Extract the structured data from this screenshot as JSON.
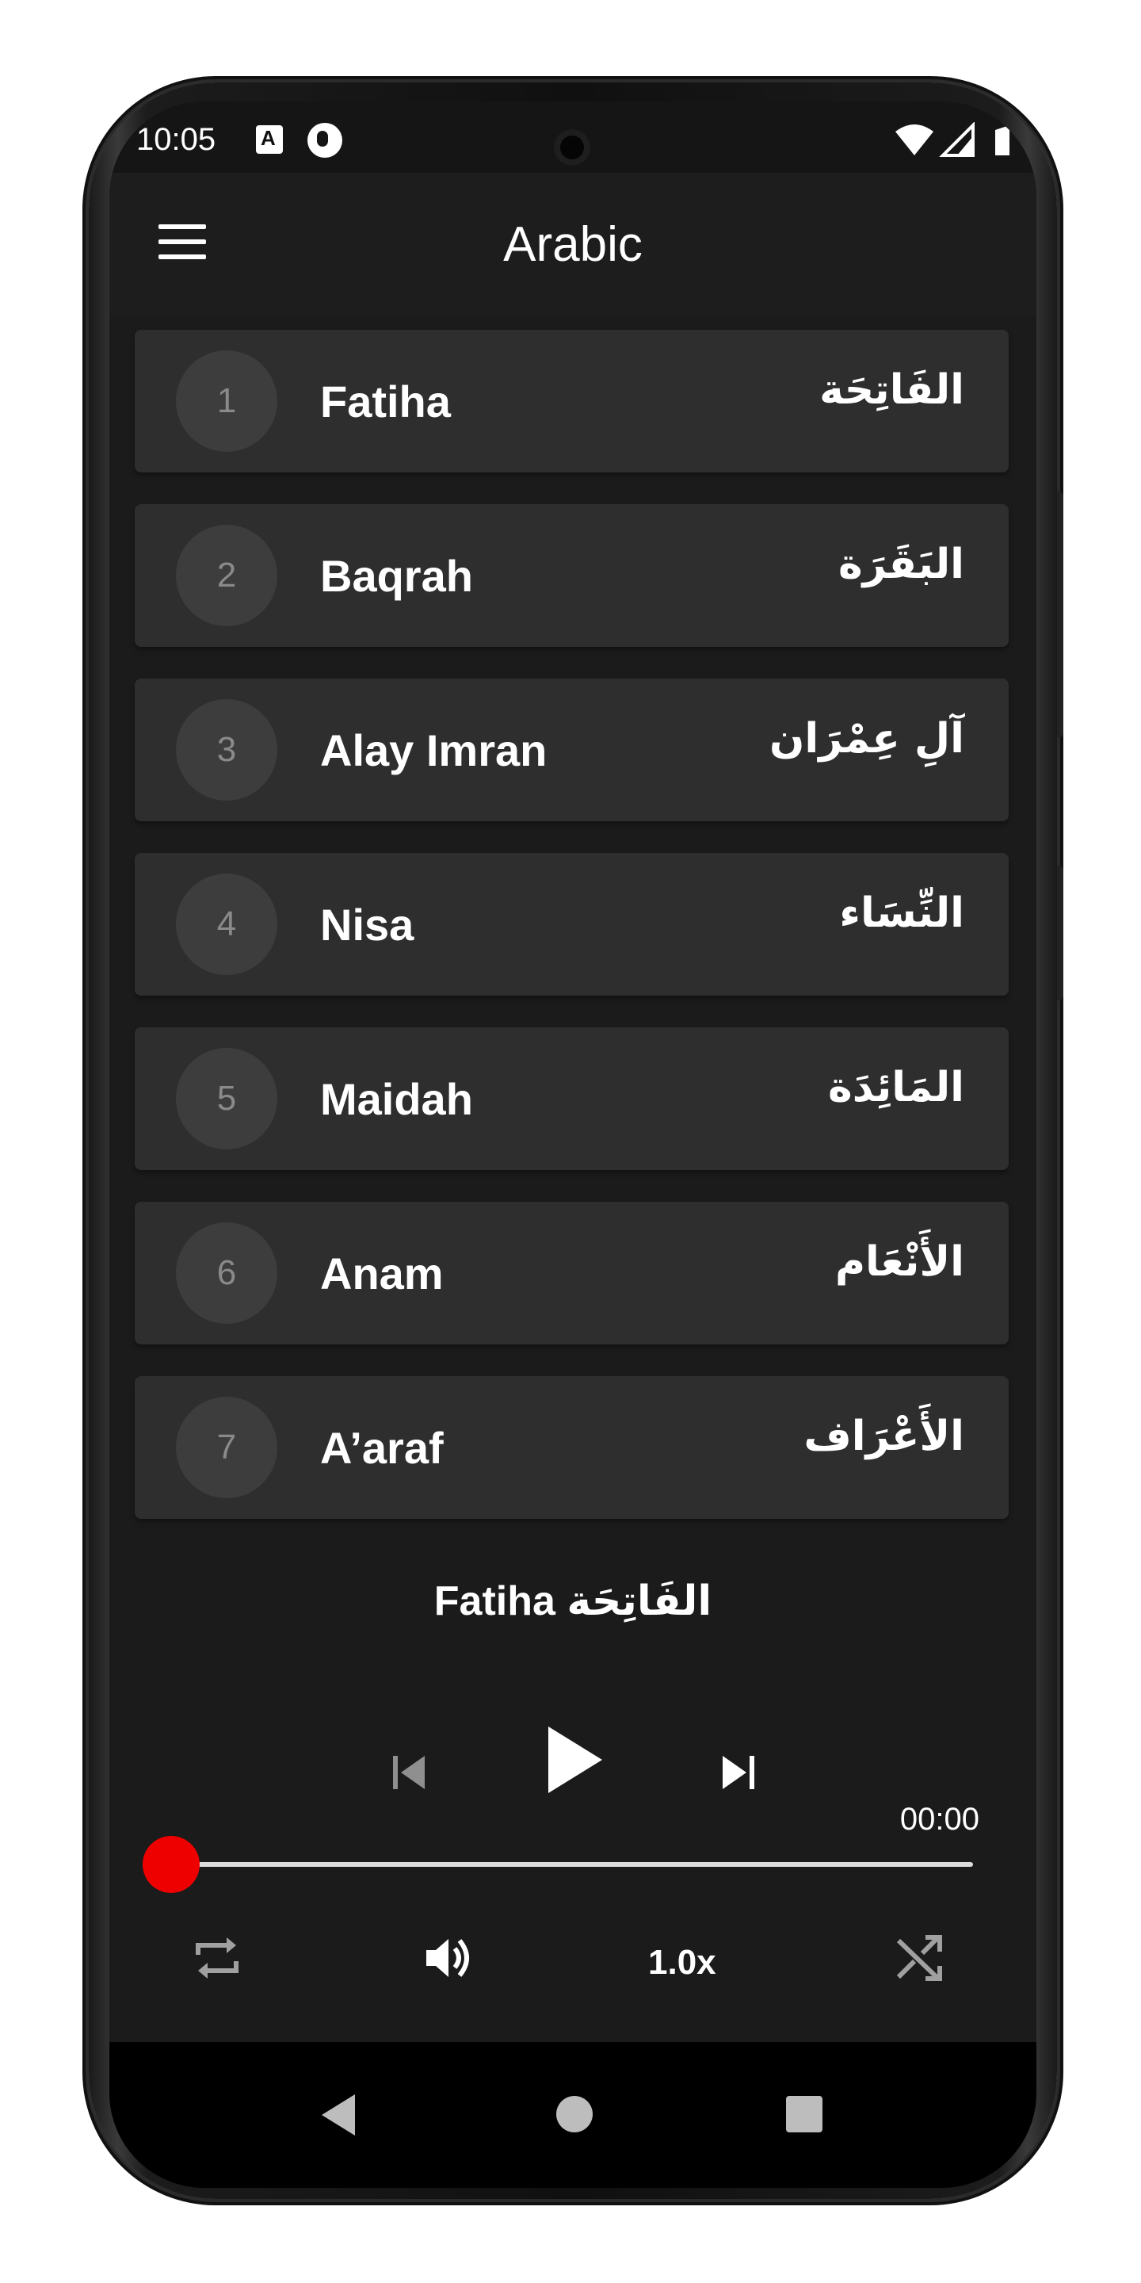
{
  "status_bar": {
    "time": "10:05",
    "icons": [
      "a-notification-icon",
      "app-notification-icon",
      "wifi-icon",
      "signal-icon",
      "battery-icon"
    ]
  },
  "app_bar": {
    "title": "Arabic",
    "menu_icon": "menu-icon"
  },
  "surahs": [
    {
      "number": "1",
      "name": "Fatiha",
      "arabic": "الفَاتِحَة"
    },
    {
      "number": "2",
      "name": "Baqrah",
      "arabic": "البَقَرَة"
    },
    {
      "number": "3",
      "name": "Alay Imran",
      "arabic": "آلِ عِمْرَان"
    },
    {
      "number": "4",
      "name": "Nisa",
      "arabic": "النِّسَاء"
    },
    {
      "number": "5",
      "name": "Maidah",
      "arabic": "المَائِدَة"
    },
    {
      "number": "6",
      "name": "Anam",
      "arabic": "الأَنْعَام"
    },
    {
      "number": "7",
      "name": "A’araf",
      "arabic": "الأَعْرَاف"
    }
  ],
  "player": {
    "now_playing_name": "Fatiha",
    "now_playing_arabic": "الفَاتِحَة",
    "elapsed": "00:00",
    "progress": 0,
    "speed": "1.0x",
    "accent_color": "#ef0000"
  },
  "nav": {
    "back": "back-icon",
    "home": "home-icon",
    "recents": "recents-icon"
  }
}
